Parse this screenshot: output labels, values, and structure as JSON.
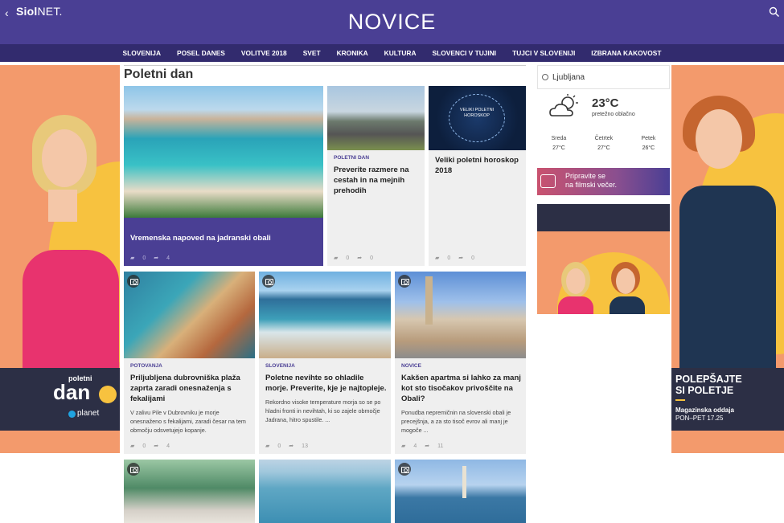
{
  "header": {
    "back": "‹",
    "logo_bold": "Siol",
    "logo_rest": "NET.",
    "title": "NOVICE"
  },
  "nav": [
    "SLOVENIJA",
    "POSEL DANES",
    "VOLITVE 2018",
    "SVET",
    "KRONIKA",
    "KULTURA",
    "SLOVENCI V TUJINI",
    "TUJCI V SLOVENIJI",
    "IZBRANA KAKOVOST"
  ],
  "section": {
    "title": "Poletni dan"
  },
  "cards": {
    "main": {
      "headline": "Vremenska napoved na jadranski obali",
      "comments": "0",
      "shares": "4"
    },
    "c2": {
      "category": "POLETNI DAN",
      "headline": "Preverite razmere na cestah in na mejnih prehodih",
      "comments": "0",
      "shares": "0"
    },
    "c3": {
      "headline": "Veliki poletni horoskop 2018",
      "image_text": "VELIKI POLETNI HOROSKOP",
      "comments": "0",
      "shares": "0"
    },
    "c4": {
      "category": "POTOVANJA",
      "headline": "Priljubljena dubrovniška plaža zaprta zaradi onesnaženja s fekalijami",
      "desc": "V zalivu Pile v Dubrovniku je morje onesnaženo s fekalijami, zaradi česar na tem območju odsvetujejo kopanje.",
      "comments": "0",
      "shares": "4"
    },
    "c5": {
      "category": "SLOVENIJA",
      "headline": "Poletne nevihte so ohladile morje. Preverite, kje je najtopleje.",
      "desc": "Rekordno visoke temperature morja so se po hladni fronti in nevihtah, ki so zajele območje Jadrana, hitro spustile. ...",
      "comments": "0",
      "shares": "13"
    },
    "c6": {
      "category": "NOVICE",
      "headline": "Kakšen apartma si lahko za manj kot sto tisočakov privoščite na Obali?",
      "desc": "Ponudba nepremičnin na slovenski obali je precejšnja, a za sto tisoč evrov ali manj je mogoče ...",
      "comments": "4",
      "shares": "11"
    }
  },
  "weather": {
    "city": "Ljubljana",
    "temp": "23°C",
    "condition": "pretežno oblačno",
    "days": [
      {
        "day": "Sreda",
        "temp": "27°C"
      },
      {
        "day": "Četrtek",
        "temp": "27°C"
      },
      {
        "day": "Petek",
        "temp": "26°C"
      }
    ]
  },
  "promo": {
    "line1": "Pripravite se",
    "line2": "na filmski večer."
  },
  "ad_left": {
    "brand_line1": "poletni",
    "brand_line2": "dan",
    "sponsor": "planet"
  },
  "ad_right": {
    "line1": "POLEPŠAJTE",
    "line2": "SI POLETJE",
    "line3": "Magazinska oddaja",
    "line4": "PON–PET 17.25"
  },
  "colors": {
    "brand": "#4a3f94",
    "nav": "#322b6e",
    "ad_bg": "#f39a6c"
  }
}
